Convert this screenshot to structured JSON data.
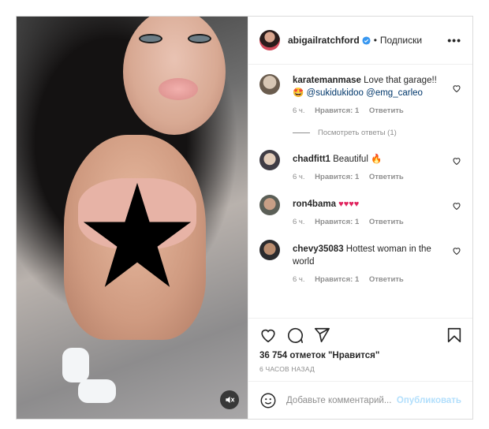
{
  "post": {
    "username": "abigailratchford",
    "verified_icon": "verified-badge-icon",
    "separator": "•",
    "follow_label": "Подписки",
    "more_label": "•••"
  },
  "comments": [
    {
      "username": "karatemanmase",
      "text": "Love that garage!!",
      "emoji": "🤩",
      "mentions": [
        "@sukidukidoo",
        "@emg_carleo"
      ],
      "time": "6 ч.",
      "likes": "Нравится: 1",
      "reply": "Ответить"
    },
    {
      "username": "chadfitt1",
      "text": "Beautiful",
      "emoji": "🔥",
      "time": "6 ч.",
      "likes": "Нравится: 1",
      "reply": "Ответить"
    },
    {
      "username": "ron4bama",
      "text": "",
      "emoji": "♥♥♥♥",
      "time": "6 ч.",
      "likes": "Нравится: 1",
      "reply": "Ответить"
    },
    {
      "username": "chevy35083",
      "text": "Hottest woman in the world",
      "time": "6 ч.",
      "likes": "Нравится: 1",
      "reply": "Ответить"
    }
  ],
  "view_replies": "Посмотреть ответы (1)",
  "actions": {
    "icons": [
      "heart-icon",
      "comment-icon",
      "share-icon",
      "bookmark-icon"
    ],
    "likes_text": "36 754 отметок \"Нравится\"",
    "time_ago": "6 ЧАСОВ НАЗАД"
  },
  "add_comment": {
    "placeholder": "Добавьте комментарий...",
    "publish_label": "Опубликовать"
  },
  "colors": {
    "link": "#00376b",
    "muted": "#8e8e8e",
    "publish_disabled": "#b2dffc",
    "verified": "#3897f0"
  }
}
